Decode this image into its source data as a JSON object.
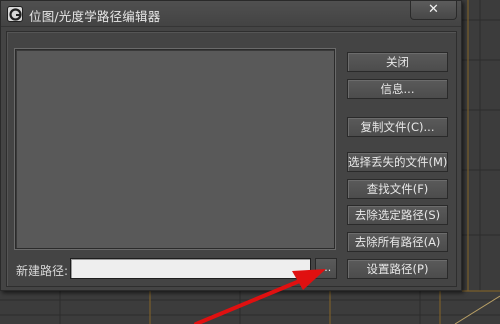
{
  "window": {
    "title": "位图/光度学路径编辑器",
    "close_glyph": "✕"
  },
  "buttons": {
    "close": "关闭",
    "info": "信息...",
    "copy_files": "复制文件(C)...",
    "select_missing": "选择丢失的文件(M)",
    "find_files": "查找文件(F)",
    "strip_selected": "去除选定路径(S)",
    "strip_all": "去除所有路径(A)",
    "set_path": "设置路径(P)"
  },
  "new_path": {
    "label": "新建路径:",
    "value": "",
    "browse_label": "..."
  },
  "colors": {
    "annotation_arrow": "#e01010",
    "dialog_bg": "#444444",
    "list_bg": "#595959"
  }
}
